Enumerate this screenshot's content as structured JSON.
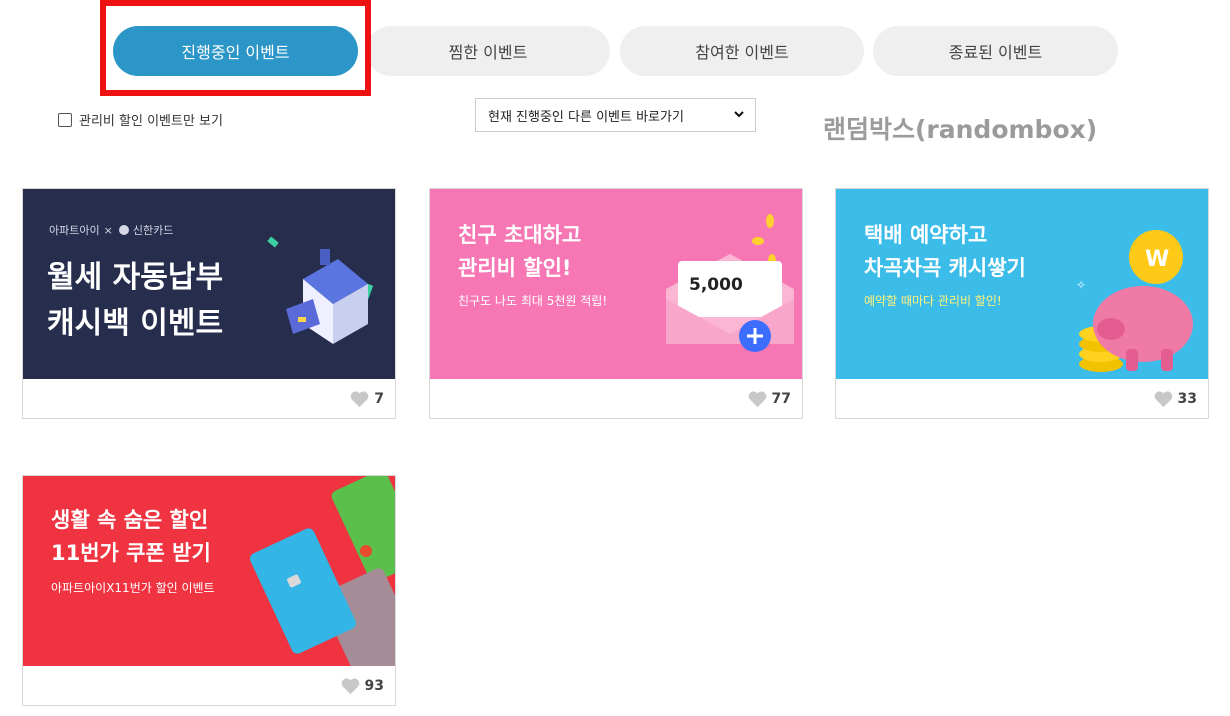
{
  "tabs": [
    {
      "label": "진행중인 이벤트",
      "active": true
    },
    {
      "label": "찜한 이벤트",
      "active": false
    },
    {
      "label": "참여한 이벤트",
      "active": false
    },
    {
      "label": "종료된 이벤트",
      "active": false
    }
  ],
  "filter": {
    "checkbox_label": "관리비 할인 이벤트만 보기",
    "checked": false
  },
  "select": {
    "selected": "현재 진행중인 다른 이벤트 바로가기"
  },
  "randombox": "랜덤박스(randombox)",
  "cards": [
    {
      "brand_left": "아파트아이",
      "brand_sep": "×",
      "brand_right": "신한카드",
      "title_line1": "월세 자동납부",
      "title_line2": "캐시백 이벤트",
      "likes": "7",
      "color": "#272d4d"
    },
    {
      "title_line1": "친구 초대하고",
      "title_line2": "관리비 할인!",
      "subtitle": "친구도 나도 최대 5천원 적립!",
      "envelope_amount": "5,000",
      "likes": "77",
      "color": "#f677b3"
    },
    {
      "title_line1": "택배 예약하고",
      "title_line2": "차곡차곡 캐시쌓기",
      "subtitle": "예약할 때마다 관리비 할인!",
      "coin_letter": "W",
      "likes": "33",
      "color": "#3cbce8"
    },
    {
      "title_line1": "생활 속 숨은 할인",
      "title_line2": "11번가 쿠폰 받기",
      "subtitle": "아파트아이X11번가 할인 이벤트",
      "likes": "93",
      "color": "#ef3340"
    }
  ],
  "colors": {
    "active_tab": "#2b96c7",
    "highlight": "#ee1111",
    "inactive_tab": "#efefef"
  },
  "icons": {
    "like": "heart-icon",
    "select": "chevron-down-icon",
    "plus": "plus-icon"
  }
}
